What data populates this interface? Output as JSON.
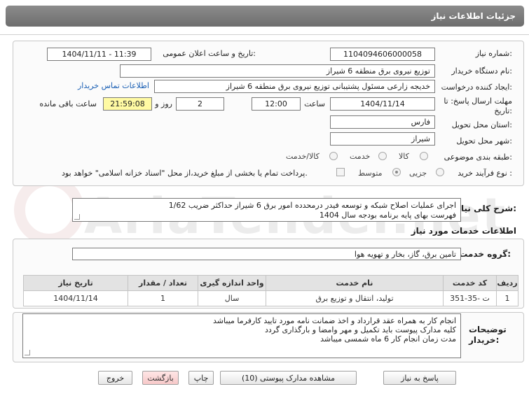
{
  "header": {
    "title": "جزئیات اطلاعات نیاز"
  },
  "watermark": {
    "text": "AriaTender.net"
  },
  "form": {
    "need_number_label": "شماره نیاز:",
    "need_number": "1104094606000058",
    "announce_label": "تاریخ و ساعت اعلان عمومی:",
    "announce_value": "1404/11/11 - 11:39",
    "buyer_label": "نام دستگاه خریدار:",
    "buyer_value": "توزیع نیروی برق منطقه 6 شیراز",
    "creator_label": "ایجاد کننده درخواست:",
    "creator_value": "خدیجه زارعی مسئول پشتیبانی توزیع نیروی برق منطقه 6 شیراز",
    "contact_link": "اطلاعات تماس خریدار",
    "deadline_label": "مهلت ارسال پاسخ: تا تاریخ:",
    "deadline_date": "1404/11/14",
    "time_label": "ساعت",
    "deadline_time": "12:00",
    "days_value": "2",
    "days_label": "روز و",
    "remaining_time": "21:59:08",
    "remaining_label": "ساعت باقی مانده",
    "province_label": "استان محل تحویل:",
    "province_value": "فارس",
    "city_label": "شهر محل تحویل:",
    "city_value": "شیراز",
    "category_label": "طبقه بندی موضوعی:",
    "category_options": [
      "کالا",
      "خدمت",
      "کالا/خدمت"
    ],
    "process_label": "نوع فرآیند خرید :",
    "process_options": [
      "جزیی",
      "متوسط"
    ],
    "payment_note": "پرداخت تمام یا بخشی از مبلغ خرید،از محل \"اسناد خزانه اسلامی\" خواهد بود."
  },
  "summary": {
    "label": "شرح کلی نیاز:",
    "text_line1": "اجرای عملیات اصلاح شبکه و توسعه فیدر درمحدده امور برق 6 شیراز حداکثر ضریب 1/62",
    "text_line2": "فهرست بهای پایه برنامه بودجه سال 1404"
  },
  "services": {
    "section_title": "اطلاعات خدمات مورد نیاز",
    "group_label": "گروه خدمت:",
    "group_value": "تامین برق، گاز، بخار و تهویه هوا",
    "columns": [
      "ردیف",
      "کد خدمت",
      "نام خدمت",
      "واحد اندازه گیری",
      "تعداد / مقدار",
      "تاریخ نیاز"
    ],
    "rows": [
      {
        "index": "1",
        "code": "ت -35-351",
        "name": "تولید، انتقال و توزیع برق",
        "unit": "سال",
        "qty": "1",
        "date": "1404/11/14"
      }
    ]
  },
  "notes": {
    "label": "توضیحات خریدار:",
    "line1": "انجام کار به همراه عقد قرارداد و اخذ ضمانت نامه مورد تایید کارفرما میباشد",
    "line2": "کلیه مدارک پیوست باید تکمیل و مهر وامضا و بارگذاری گردد",
    "line3": "مدت زمان انجام کار 6 ماه شمسی میباشد"
  },
  "buttons": {
    "reply": "پاسخ به نیاز",
    "attachments": "مشاهده مدارک پیوستی (10)",
    "print": "چاپ",
    "back": "بازگشت",
    "exit": "خروج"
  }
}
